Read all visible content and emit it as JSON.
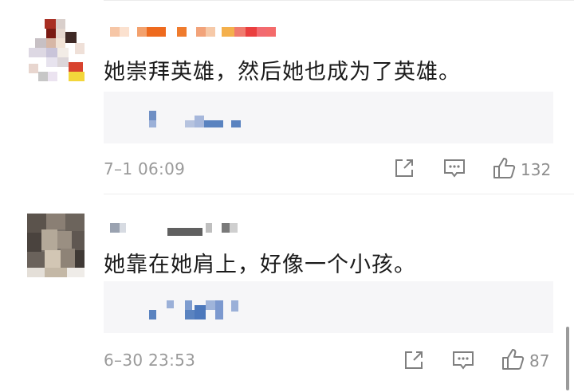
{
  "comments": [
    {
      "text": "她崇拜英雄，然后她也成为了英雄。",
      "timestamp": "7–1 06:09",
      "likes": "132",
      "avatar_icon": "blurred-avatar",
      "username_obscured": true
    },
    {
      "text": "她靠在她肩上，好像一个小孩。",
      "timestamp": "6–30 23:53",
      "likes": "87",
      "avatar_icon": "blurred-avatar",
      "username_obscured": true
    }
  ],
  "icons": {
    "share": "share-icon",
    "reply": "comment-icon",
    "like": "thumbs-up-icon"
  },
  "colors": {
    "text": "#1b1b1b",
    "meta": "#9a9a9a",
    "reply_bg": "#f6f6f8",
    "icon": "#7f7f7f"
  }
}
